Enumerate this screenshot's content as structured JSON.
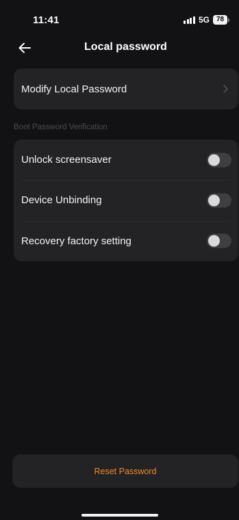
{
  "status_bar": {
    "time": "11:41",
    "network": "5G",
    "battery": "78",
    "icons": [
      "signal-icon",
      "battery-icon"
    ]
  },
  "nav": {
    "title": "Local password",
    "back_icon": "back-arrow-icon"
  },
  "modify": {
    "label": "Modify Local Password",
    "chevron_icon": "chevron-right-icon"
  },
  "boot_section": {
    "title": "Boot Password Verification",
    "items": [
      {
        "label": "Unlock screensaver",
        "enabled": false
      },
      {
        "label": "Device Unbinding",
        "enabled": false
      },
      {
        "label": "Recovery factory setting",
        "enabled": false
      }
    ]
  },
  "reset": {
    "label": "Reset Password"
  },
  "colors": {
    "background": "#121113",
    "card": "#232224",
    "accent": "#f08a2e",
    "section_title": "#4d4c50",
    "toggle_off": "#3f3e42"
  }
}
